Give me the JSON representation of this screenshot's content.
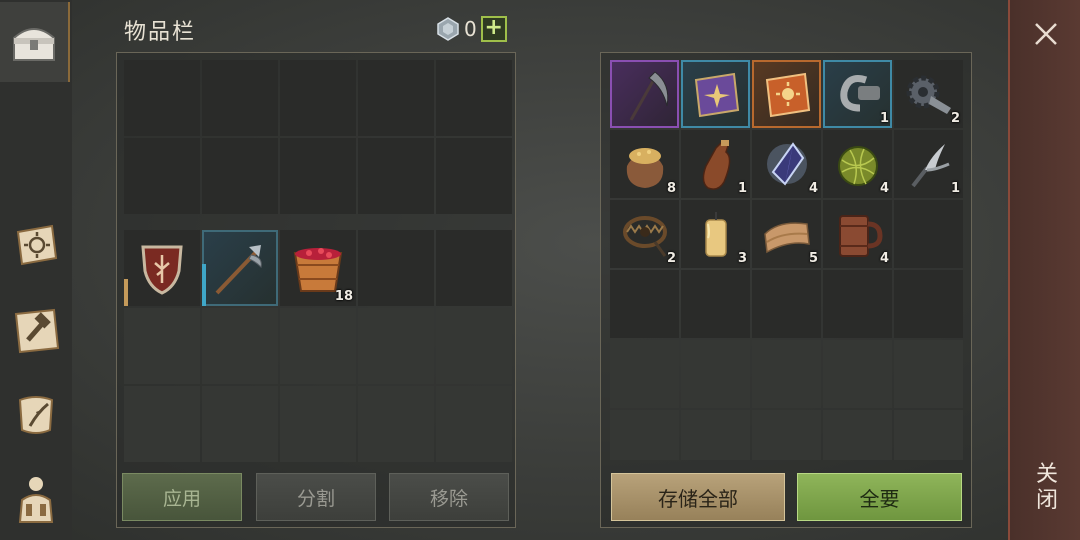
{
  "nav": {
    "tabs": [
      {
        "name": "chest",
        "icon": "chest-icon",
        "active": true
      },
      {
        "name": "skills",
        "icon": "sun-book-icon",
        "active": false
      },
      {
        "name": "crafting",
        "icon": "hammer-map-icon",
        "active": false
      },
      {
        "name": "quests",
        "icon": "scroll-quill-icon",
        "active": false
      },
      {
        "name": "character",
        "icon": "backpack-character-icon",
        "active": false
      }
    ]
  },
  "header": {
    "title": "物品栏",
    "gem_icon": "gem-icon",
    "gem_count": "0",
    "plus_label": "+"
  },
  "inventory": {
    "equipped_row": [
      {
        "icon": "shield-icon",
        "count": "",
        "durability": 0.35,
        "durability_color": "#c49a5a"
      },
      {
        "icon": "halberd-icon",
        "count": "",
        "durability": 0.55,
        "durability_color": "#3fa7c8"
      },
      {
        "icon": "berry-bucket-icon",
        "count": "18"
      }
    ]
  },
  "storage": {
    "items": [
      {
        "icon": "scythe-icon",
        "count": "",
        "quality": "purple"
      },
      {
        "icon": "purple-recipe-book-icon",
        "count": "",
        "quality": "blue"
      },
      {
        "icon": "orange-sun-book-icon",
        "count": "",
        "quality": "orange"
      },
      {
        "icon": "metal-hook-icon",
        "count": "1",
        "quality": "blue"
      },
      {
        "icon": "gear-part-icon",
        "count": "2",
        "quality": ""
      },
      {
        "icon": "grain-sack-icon",
        "count": "8",
        "quality": ""
      },
      {
        "icon": "leather-flask-icon",
        "count": "1",
        "quality": ""
      },
      {
        "icon": "crystal-shard-icon",
        "count": "4",
        "quality": ""
      },
      {
        "icon": "plant-fiber-ball-icon",
        "count": "4",
        "quality": ""
      },
      {
        "icon": "fork-tool-icon",
        "count": "1",
        "quality": ""
      },
      {
        "icon": "bear-trap-icon",
        "count": "2",
        "quality": ""
      },
      {
        "icon": "candle-icon",
        "count": "3",
        "quality": ""
      },
      {
        "icon": "folded-cloth-icon",
        "count": "5",
        "quality": ""
      },
      {
        "icon": "wooden-mug-icon",
        "count": "4",
        "quality": ""
      }
    ]
  },
  "buttons": {
    "apply": "应用",
    "split": "分割",
    "remove": "移除",
    "store_all": "存储全部",
    "take_all": "全要"
  },
  "close": {
    "icon": "close-icon",
    "label": "关闭"
  }
}
